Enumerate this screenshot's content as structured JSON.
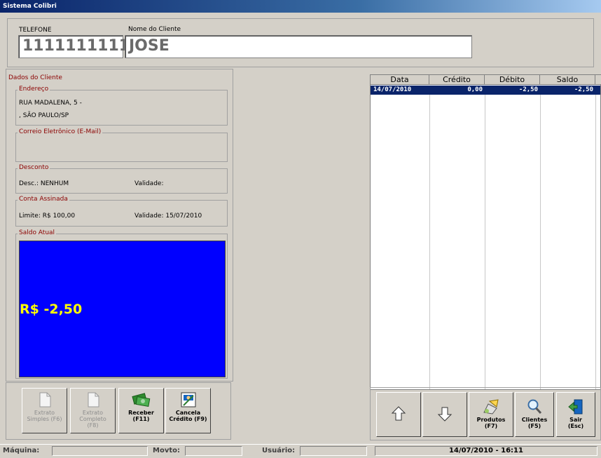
{
  "window": {
    "title": "Sistema Colibri"
  },
  "header": {
    "phone_label": "TELEFONE",
    "phone_value": "1111111111",
    "name_label": "Nome do Cliente",
    "name_value": "JOSE"
  },
  "client": {
    "section_title": "Dados do Cliente",
    "address": {
      "title": "Endereço",
      "line1": "RUA MADALENA, 5 -",
      "line2": ", SÃO PAULO/SP"
    },
    "email": {
      "title": "Correio Eletrônico (E-Mail)",
      "value": ""
    },
    "discount": {
      "title": "Desconto",
      "desc": "Desc.: NENHUM",
      "validity": "Validade:"
    },
    "signed_account": {
      "title": "Conta Assinada",
      "limit": "Limite: R$  100,00",
      "validity": "Validade: 15/07/2010"
    },
    "balance": {
      "title": "Saldo Atual",
      "value": "R$ -2,50",
      "bg_color": "#0000ff",
      "text_color": "#ffff00"
    }
  },
  "grid": {
    "columns": [
      "Data",
      "Crédito",
      "Débito",
      "Saldo"
    ],
    "rows": [
      {
        "data": "14/07/2010",
        "credito": "0,00",
        "debito": "-2,50",
        "saldo": "-2,50"
      }
    ],
    "selected_color": "#0a246a"
  },
  "left_buttons": [
    {
      "line1": "Extrato",
      "line2": "Simples (F6)",
      "enabled": false,
      "icon": "document-icon"
    },
    {
      "line1": "Extrato",
      "line2": "Completo",
      "line3": "(F8)",
      "enabled": false,
      "icon": "document-icon"
    },
    {
      "line1": "Receber",
      "line2": "(F11)",
      "enabled": true,
      "icon": "money-icon"
    },
    {
      "line1": "Cancela",
      "line2": "Crédito (F9)",
      "enabled": true,
      "icon": "cancel-credit-icon"
    }
  ],
  "right_buttons": [
    {
      "label": "",
      "icon": "arrow-up-icon"
    },
    {
      "label": "",
      "icon": "arrow-down-icon"
    },
    {
      "line1": "Produtos",
      "line2": "(F7)",
      "icon": "products-icon"
    },
    {
      "line1": "Clientes",
      "line2": "(F5)",
      "icon": "search-icon"
    },
    {
      "line1": "Sair",
      "line2": "(Esc)",
      "icon": "exit-icon"
    }
  ],
  "statusbar": {
    "machine_label": "Máquina:",
    "machine_value": "",
    "movto_label": "Movto:",
    "movto_value": "",
    "user_label": "Usuário:",
    "user_value": "",
    "datetime": "14/07/2010 - 16:11"
  }
}
